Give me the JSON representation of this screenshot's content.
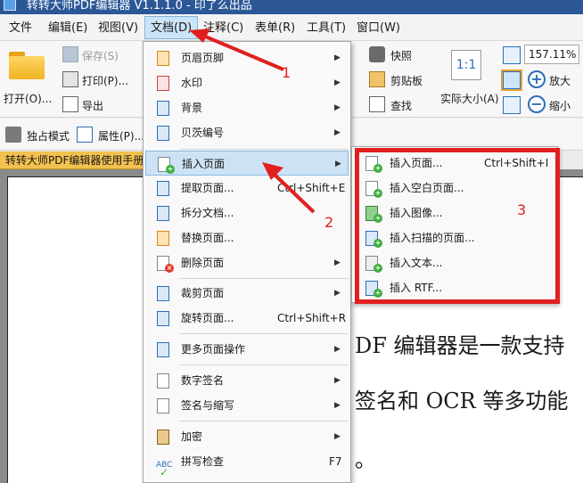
{
  "window": {
    "title": "转转大师PDF编辑器 V1.1.1.0 - 印了么出品"
  },
  "menubar": [
    {
      "label": "文件"
    },
    {
      "label": "编辑(E)"
    },
    {
      "label": "视图(V)"
    },
    {
      "label": "文档(D)"
    },
    {
      "label": "注释(C)"
    },
    {
      "label": "表单(R)"
    },
    {
      "label": "工具(T)"
    },
    {
      "label": "窗口(W)"
    }
  ],
  "ribbon": {
    "open": "打开(O)...",
    "save": "保存(S)",
    "print": "打印(P)...",
    "export": "导出",
    "snapshot": "快照",
    "clipboard": "剪贴板",
    "find": "查找",
    "actual_size": "实际大小(A)",
    "actual_size_glyph": "1:1",
    "zoom_value": "157.11%",
    "zoom_in": "放大",
    "zoom_out": "缩小",
    "exclusive_mode": "独占模式",
    "properties": "属性(P)...",
    "annotate_partial": "释"
  },
  "document_tab": "转转大师PDF编辑器使用手册",
  "document_lines": [
    "DF 编辑器是一款支持",
    "签名和 OCR 等多功能",
    "。"
  ],
  "document_menu": [
    {
      "label": "页眉页脚",
      "shortcut": "",
      "has_submenu": true,
      "icon": "header-footer-icon"
    },
    {
      "label": "水印",
      "shortcut": "",
      "has_submenu": true,
      "icon": "watermark-icon"
    },
    {
      "label": "背景",
      "shortcut": "",
      "has_submenu": true,
      "icon": "background-icon"
    },
    {
      "label": "贝茨编号",
      "shortcut": "",
      "has_submenu": true,
      "icon": "bates-number-icon"
    },
    {
      "label": "插入页面",
      "shortcut": "",
      "has_submenu": true,
      "icon": "insert-page-icon"
    },
    {
      "label": "提取页面...",
      "shortcut": "Ctrl+Shift+E",
      "has_submenu": false,
      "icon": "extract-page-icon"
    },
    {
      "label": "拆分文档...",
      "shortcut": "",
      "has_submenu": false,
      "icon": "split-document-icon"
    },
    {
      "label": "替换页面...",
      "shortcut": "",
      "has_submenu": false,
      "icon": "replace-page-icon"
    },
    {
      "label": "删除页面",
      "shortcut": "",
      "has_submenu": true,
      "icon": "delete-page-icon"
    },
    {
      "label": "裁剪页面",
      "shortcut": "",
      "has_submenu": true,
      "icon": "crop-page-icon"
    },
    {
      "label": "旋转页面...",
      "shortcut": "Ctrl+Shift+R",
      "has_submenu": false,
      "icon": "rotate-page-icon"
    },
    {
      "label": "更多页面操作",
      "shortcut": "",
      "has_submenu": true,
      "icon": "more-page-ops-icon"
    },
    {
      "label": "数字签名",
      "shortcut": "",
      "has_submenu": true,
      "icon": "digital-signature-icon"
    },
    {
      "label": "签名与缩写",
      "shortcut": "",
      "has_submenu": true,
      "icon": "signature-initials-icon"
    },
    {
      "label": "加密",
      "shortcut": "",
      "has_submenu": true,
      "icon": "encrypt-icon"
    },
    {
      "label": "拼写检查",
      "shortcut": "F7",
      "has_submenu": false,
      "icon": "spell-check-icon"
    }
  ],
  "insert_submenu": [
    {
      "label": "插入页面...",
      "shortcut": "Ctrl+Shift+I",
      "icon": "insert-page-icon"
    },
    {
      "label": "插入空白页面...",
      "shortcut": "",
      "icon": "insert-blank-page-icon"
    },
    {
      "label": "插入图像...",
      "shortcut": "",
      "icon": "insert-image-icon"
    },
    {
      "label": "插入扫描的页面...",
      "shortcut": "",
      "icon": "insert-scanned-page-icon"
    },
    {
      "label": "插入文本...",
      "shortcut": "",
      "icon": "insert-text-icon"
    },
    {
      "label": "插入 RTF...",
      "shortcut": "",
      "icon": "insert-rtf-icon"
    }
  ],
  "annotations": {
    "step1": "1",
    "step2": "2",
    "step3": "3"
  },
  "colors": {
    "annotation_red": "#e02020",
    "highlight": "#cde3f5",
    "doc_tab": "#f2c14e"
  }
}
